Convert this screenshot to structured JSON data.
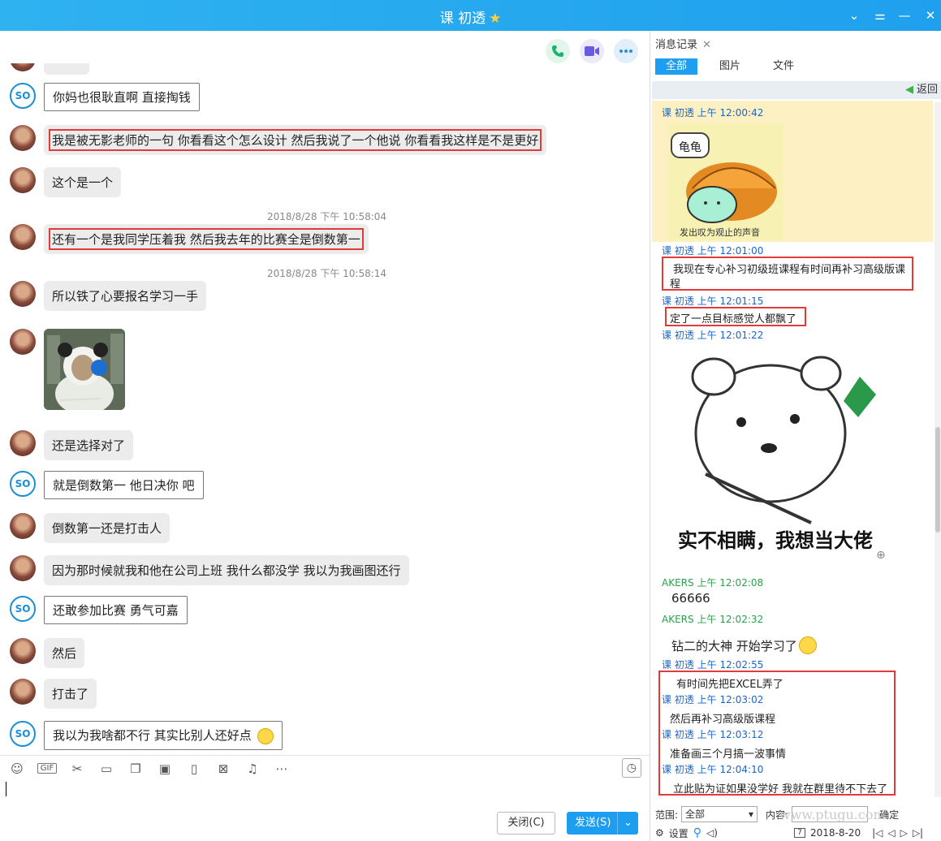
{
  "window": {
    "title": "课 初透"
  },
  "messages": [
    {
      "avatar": "user",
      "text": "你妈也很耿直啊 直接掏钱",
      "white": true
    },
    {
      "avatar": "user",
      "text": "我是被无影老师的一句  你看看这个怎么设计  然后我说了一个他说 你看看我这样是不是更好",
      "highlight": true
    },
    {
      "avatar": "user",
      "text": "这个是一个"
    },
    {
      "stamp": "2018/8/28 下午 10:58:04"
    },
    {
      "avatar": "user",
      "text": "还有一个是我同学压着我 然后我去年的比赛全是倒数第一",
      "highlight": true
    },
    {
      "stamp": "2018/8/28 下午 10:58:14"
    },
    {
      "avatar": "user",
      "text": "所以铁了心要报名学习一手"
    },
    {
      "avatar": "user",
      "sticker": true
    },
    {
      "avatar": "user",
      "text": "还是选择对了"
    },
    {
      "avatar": "so",
      "text": "就是倒数第一 他日决你 吧",
      "white": true
    },
    {
      "avatar": "user",
      "text": " 倒数第一还是打击人"
    },
    {
      "avatar": "user",
      "text": "因为那时候就我和他在公司上班 我什么都没学 我以为我画图还行"
    },
    {
      "avatar": "so",
      "text": "还敢参加比赛 勇气可嘉",
      "white": true
    },
    {
      "avatar": "user",
      "text": "然后"
    },
    {
      "avatar": "user",
      "text": "打击了"
    },
    {
      "avatar": "so",
      "text": "我以为我啥都不行 其实比别人还好点",
      "white": true
    }
  ],
  "compose": {
    "close_label": "关闭(C)",
    "send_label": "发送(S)"
  },
  "history": {
    "tab_label": "消息记录",
    "filters": [
      "全部",
      "图片",
      "文件"
    ],
    "back_label": "返回",
    "entries": {
      "e1": "课 初透 上午 12:00:42",
      "e2": "课 初透 上午 12:01:00",
      "t2": "我现在专心补习初级班课程有时间再补习高级版课",
      "t2b": "程",
      "e3": "课 初透 上午 12:01:15",
      "t3": "定了一点目标感觉人都飘了",
      "e4": "课 初透 上午 12:01:22",
      "e5": "AKERS 上午 12:02:08",
      "t5": "66666",
      "e6": "AKERS 上午 12:02:32",
      "t6": "钻二的大神 开始学习了",
      "e7": "课 初透 上午 12:02:55",
      "t7": "有时间先把EXCEL弄了",
      "e8": "课 初透 上午 12:03:02",
      "t8": "然后再补习高级版课程",
      "e9": "课 初透 上午 12:03:12",
      "t9": "准备画三个月搞一波事情",
      "e10": "课 初透 上午 12:04:10",
      "t10": "立此贴为证如果没学好 我就在群里待不下去了"
    },
    "sticker1_text": "龟龟",
    "sticker1_caption": "发出叹为观止的声音",
    "sticker2_caption": "实不相瞒，我想当大佬",
    "range_label": "范围:",
    "range_value": "全部",
    "content_label": "内容:",
    "confirm_label": "确定",
    "settings_label": "设置",
    "date": "2018-8-20"
  },
  "watermark": "www.ptugu.com",
  "colors": {
    "titlebar": "#1fa0ee",
    "highlight": "#e03a3a",
    "send": "#1e9ef0"
  }
}
